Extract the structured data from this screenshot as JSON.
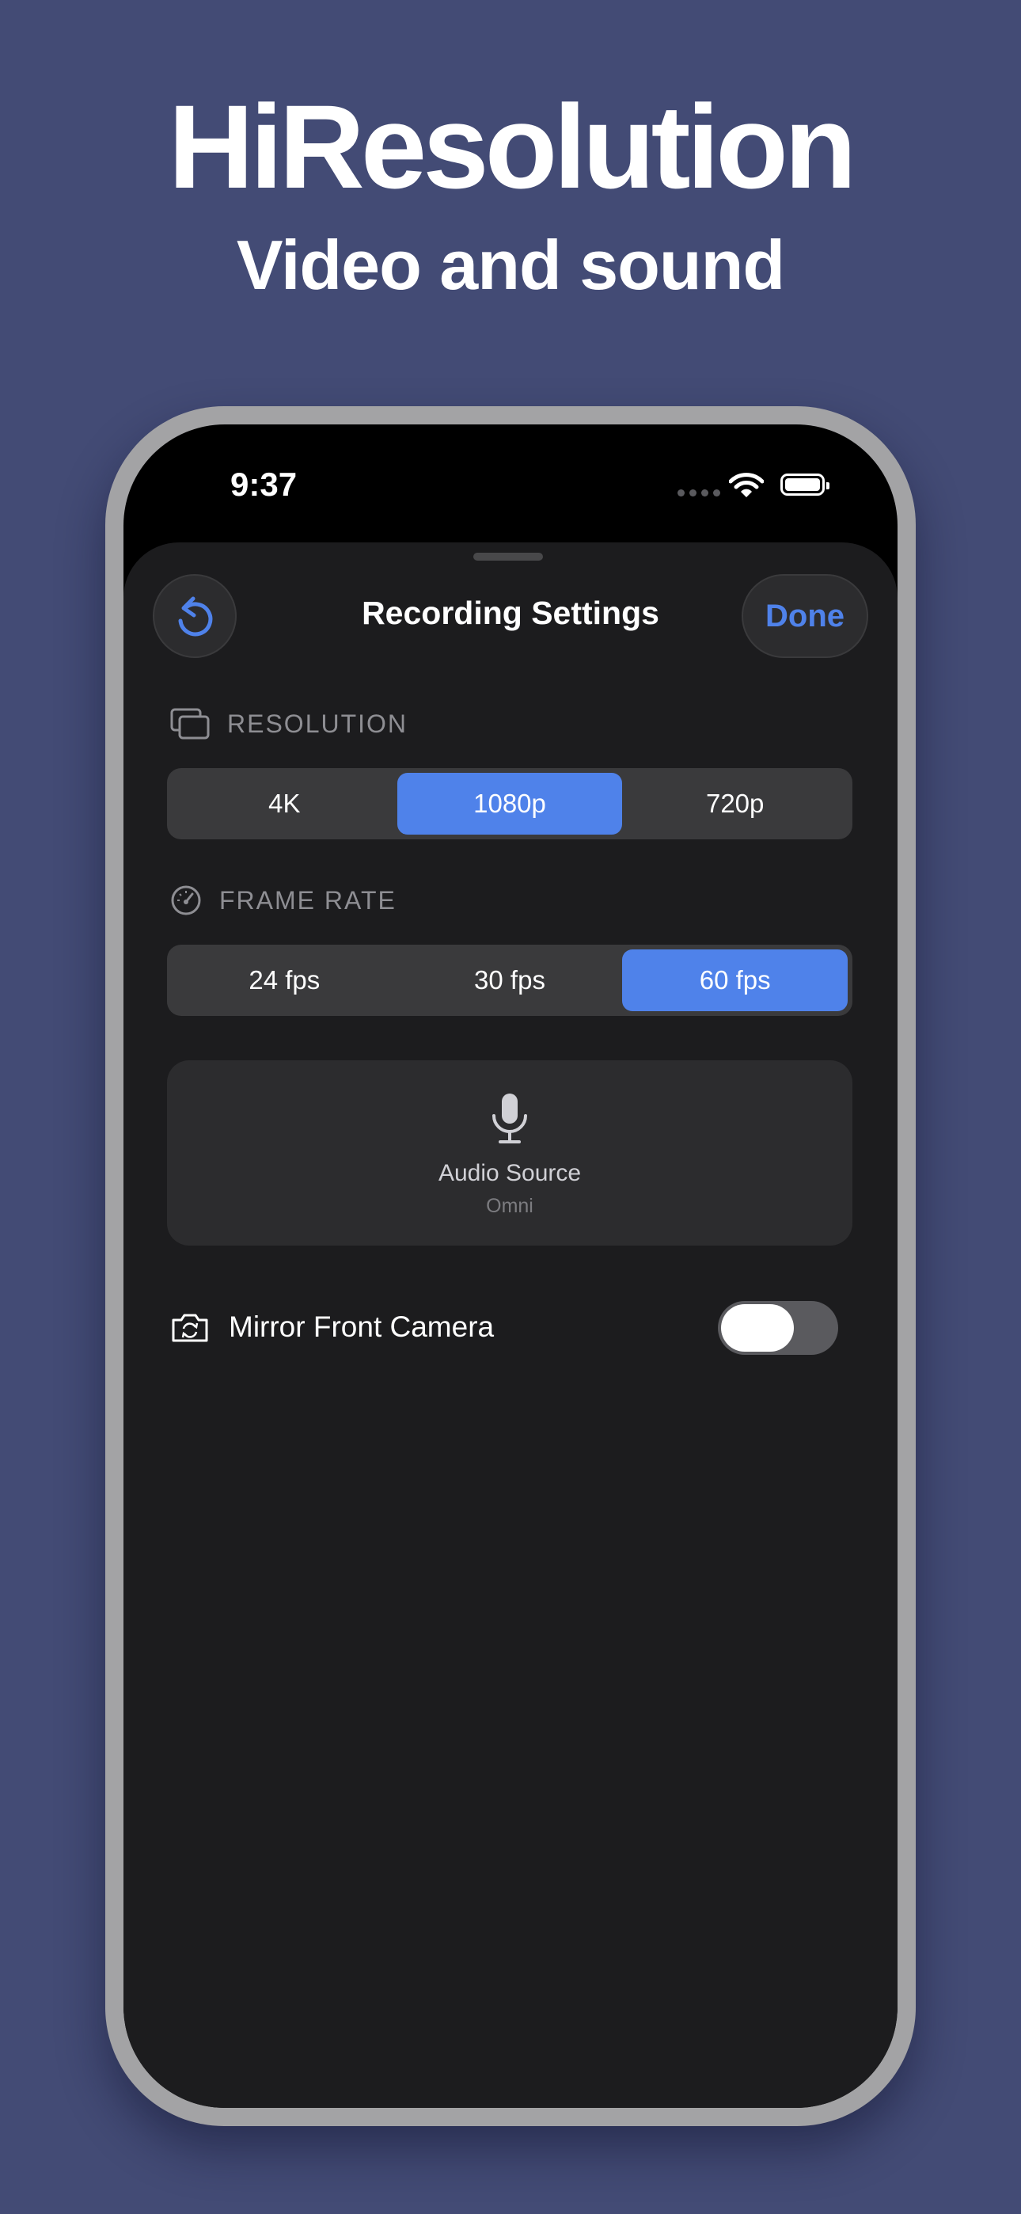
{
  "promo": {
    "headline": "HiResolution",
    "subheadline": "Video and sound"
  },
  "status_bar": {
    "time": "9:37",
    "icons": [
      "signal-dots-icon",
      "wifi-icon",
      "battery-icon"
    ]
  },
  "sheet": {
    "title": "Recording Settings",
    "reset_icon": "counterclockwise-arrow-icon",
    "done_label": "Done"
  },
  "resolution": {
    "header": "RESOLUTION",
    "icon": "stacked-rectangles-icon",
    "options": [
      "4K",
      "1080p",
      "720p"
    ],
    "selected": "1080p"
  },
  "frame_rate": {
    "header": "FRAME RATE",
    "icon": "speedometer-icon",
    "options": [
      "24 fps",
      "30 fps",
      "60 fps"
    ],
    "selected": "60 fps"
  },
  "audio_source": {
    "icon": "microphone-icon",
    "label": "Audio Source",
    "value": "Omni"
  },
  "mirror_front_camera": {
    "icon": "camera-rotate-icon",
    "label": "Mirror Front Camera",
    "enabled": false
  },
  "colors": {
    "background": "#434b75",
    "accent": "#4f82ea",
    "sheet": "#1c1c1e",
    "card": "#2c2c2e"
  }
}
